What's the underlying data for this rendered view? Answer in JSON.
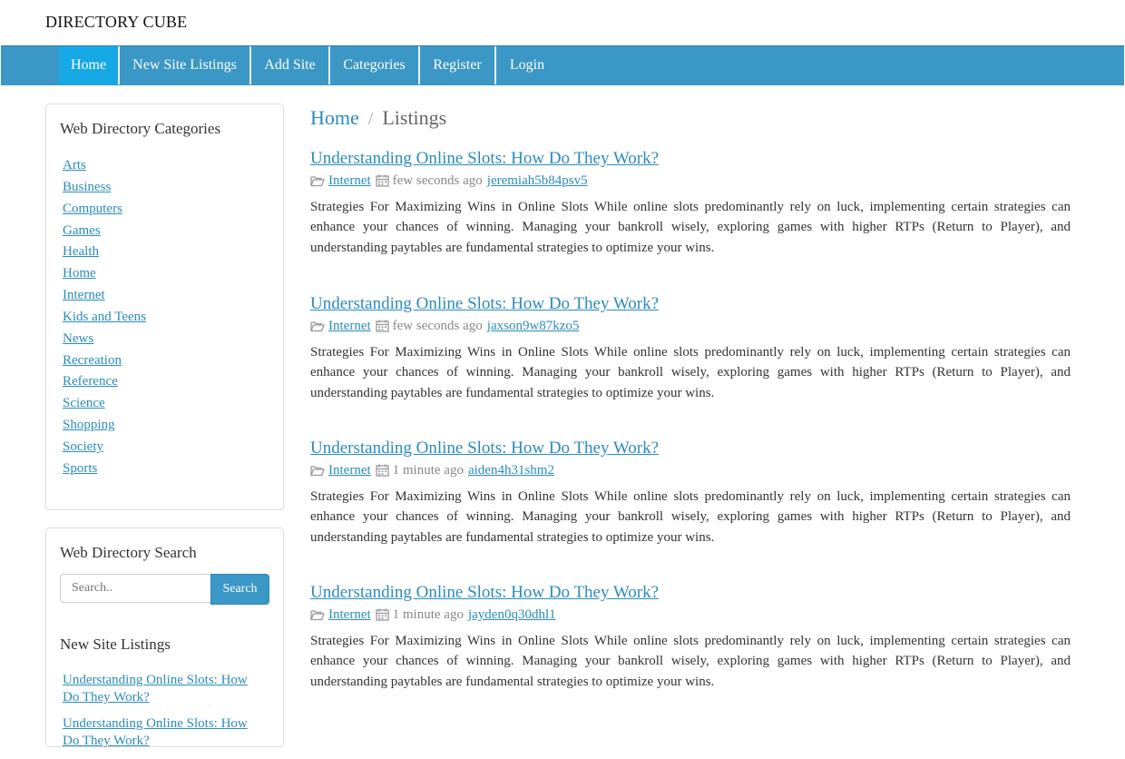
{
  "brand": "DIRECTORY CUBE",
  "nav": {
    "items": [
      "Home",
      "New Site Listings",
      "Add Site",
      "Categories",
      "Register",
      "Login"
    ],
    "active": "Home"
  },
  "sidebar": {
    "categories_title": "Web Directory Categories",
    "categories": [
      "Arts",
      "Business",
      "Computers",
      "Games",
      "Health",
      "Home",
      "Internet",
      "Kids and Teens",
      "News",
      "Recreation",
      "Reference",
      "Science",
      "Shopping",
      "Society",
      "Sports"
    ],
    "search_title": "Web Directory Search",
    "search_placeholder": "Search..",
    "search_button": "Search",
    "new_listings_title": "New Site Listings",
    "new_listings": [
      "Understanding Online Slots: How Do They Work?",
      "Understanding Online Slots: How Do They Work?"
    ]
  },
  "breadcrumb": {
    "home": "Home",
    "separator": "/",
    "current": "Listings"
  },
  "listings": [
    {
      "title": "Understanding Online Slots: How Do They Work?",
      "category": "Internet",
      "time": "few seconds ago",
      "user": "jeremiah5b84psv5",
      "description": "Strategies For Maximizing Wins in Online Slots While online slots predominantly rely on luck, implementing certain strategies can enhance your chances of winning. Managing your bankroll wisely, exploring games with higher RTPs (Return to Player), and understanding paytables are fundamental strategies to optimize your wins."
    },
    {
      "title": "Understanding Online Slots: How Do They Work?",
      "category": "Internet",
      "time": "few seconds ago",
      "user": "jaxson9w87kzo5",
      "description": "Strategies For Maximizing Wins in Online Slots While online slots predominantly rely on luck, implementing certain strategies can enhance your chances of winning. Managing your bankroll wisely, exploring games with higher RTPs (Return to Player), and understanding paytables are fundamental strategies to optimize your wins."
    },
    {
      "title": "Understanding Online Slots: How Do They Work?",
      "category": "Internet",
      "time": "1 minute ago",
      "user": "aiden4h31shm2",
      "description": "Strategies For Maximizing Wins in Online Slots While online slots predominantly rely on luck, implementing certain strategies can enhance your chances of winning. Managing your bankroll wisely, exploring games with higher RTPs (Return to Player), and understanding paytables are fundamental strategies to optimize your wins."
    },
    {
      "title": "Understanding Online Slots: How Do They Work?",
      "category": "Internet",
      "time": "1 minute ago",
      "user": "jayden0q30dhl1",
      "description": "Strategies For Maximizing Wins in Online Slots While online slots predominantly rely on luck, implementing certain strategies can enhance your chances of winning. Managing your bankroll wisely, exploring games with higher RTPs (Return to Player), and understanding paytables are fundamental strategies to optimize your wins."
    }
  ]
}
